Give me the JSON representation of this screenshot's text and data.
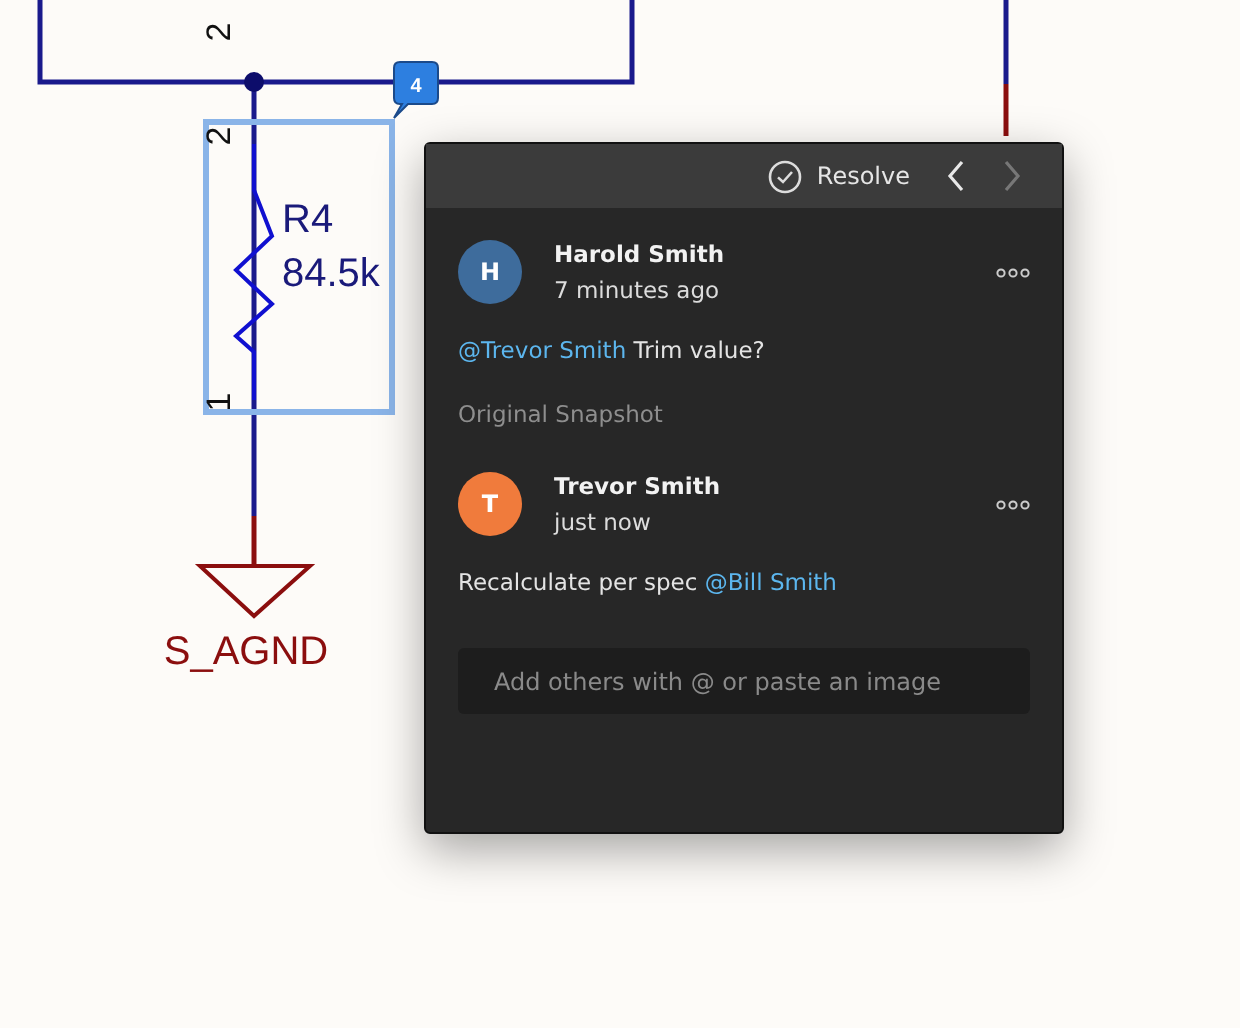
{
  "schematic": {
    "pin_numbers": [
      "2",
      "2",
      "1"
    ],
    "component": {
      "designator": "R4",
      "value": "84.5k",
      "selected": true
    },
    "ground_label": "S_AGND",
    "comment_badge": "4"
  },
  "comment_panel": {
    "resolve_label": "Resolve",
    "previous": {
      "disabled": false
    },
    "next": {
      "disabled": true
    },
    "comments": [
      {
        "avatar": "H",
        "color": "#3e6c9c",
        "author": "Harold Smith",
        "time": "7 minutes ago",
        "body": [
          {
            "kind": "mention",
            "text": "@Trevor Smith"
          },
          {
            "kind": "text",
            "text": " Trim value?"
          }
        ],
        "snapshot": "Original Snapshot"
      },
      {
        "avatar": "T",
        "color": "#f07b3c",
        "author": "Trevor Smith",
        "time": "just now",
        "body": [
          {
            "kind": "text",
            "text": "Recalculate per spec "
          },
          {
            "kind": "mention",
            "text": "@Bill Smith"
          }
        ]
      }
    ],
    "reply": {
      "placeholder": "Add others with @ or paste an image"
    }
  }
}
